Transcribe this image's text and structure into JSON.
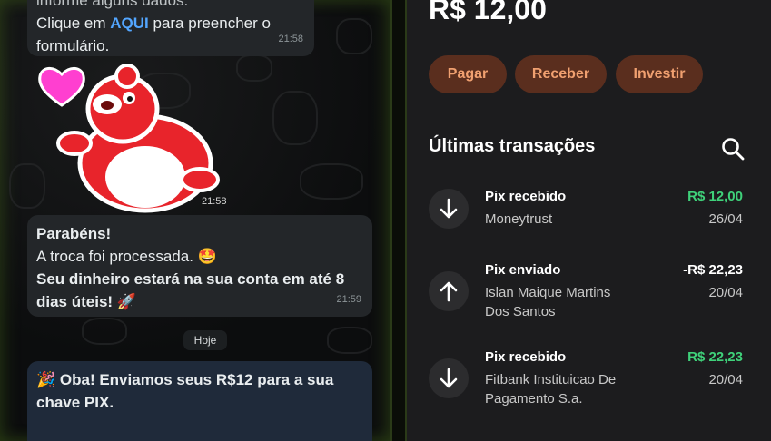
{
  "chat": {
    "message1": {
      "line1": "informe alguns dados.",
      "prefix": "Clique em ",
      "link": "AQUI",
      "suffix": " para preencher o",
      "line3": "formulário.",
      "time": "21:58"
    },
    "sticker_time": "21:58",
    "message2": {
      "title": "Parabéns!",
      "line2": "A troca foi processada. 🤩",
      "line3": "Seu dinheiro estará na sua conta em até 8",
      "line4": "dias úteis! 🚀",
      "time": "21:59"
    },
    "day_separator": "Hoje",
    "message3": {
      "line1": "🎉 Oba! Enviamos seus R$12 para a sua",
      "line2": "chave PIX."
    }
  },
  "bank": {
    "balance": "R$ 12,00",
    "actions": [
      "Pagar",
      "Receber",
      "Investir"
    ],
    "section_title": "Últimas transações",
    "search_icon": "search-icon",
    "transactions": [
      {
        "type": "Pix recebido",
        "name_line1": "Moneytrust",
        "name_line2": "",
        "amount": "R$ 12,00",
        "date": "26/04",
        "direction": "in",
        "icon": "arrow-down-icon"
      },
      {
        "type": "Pix enviado",
        "name_line1": "Islan Maique Martins",
        "name_line2": "Dos Santos",
        "amount": "-R$ 22,23",
        "date": "20/04",
        "direction": "out",
        "icon": "arrow-up-icon"
      },
      {
        "type": "Pix recebido",
        "name_line1": "Fitbank Instituicao De",
        "name_line2": "Pagamento S.a.",
        "amount": "R$ 22,23",
        "date": "20/04",
        "direction": "in",
        "icon": "arrow-down-icon"
      }
    ],
    "colors": {
      "accent_button_bg": "#5a2e1e",
      "accent_button_text": "#f0a070",
      "credit_green": "#3fd17a"
    }
  }
}
